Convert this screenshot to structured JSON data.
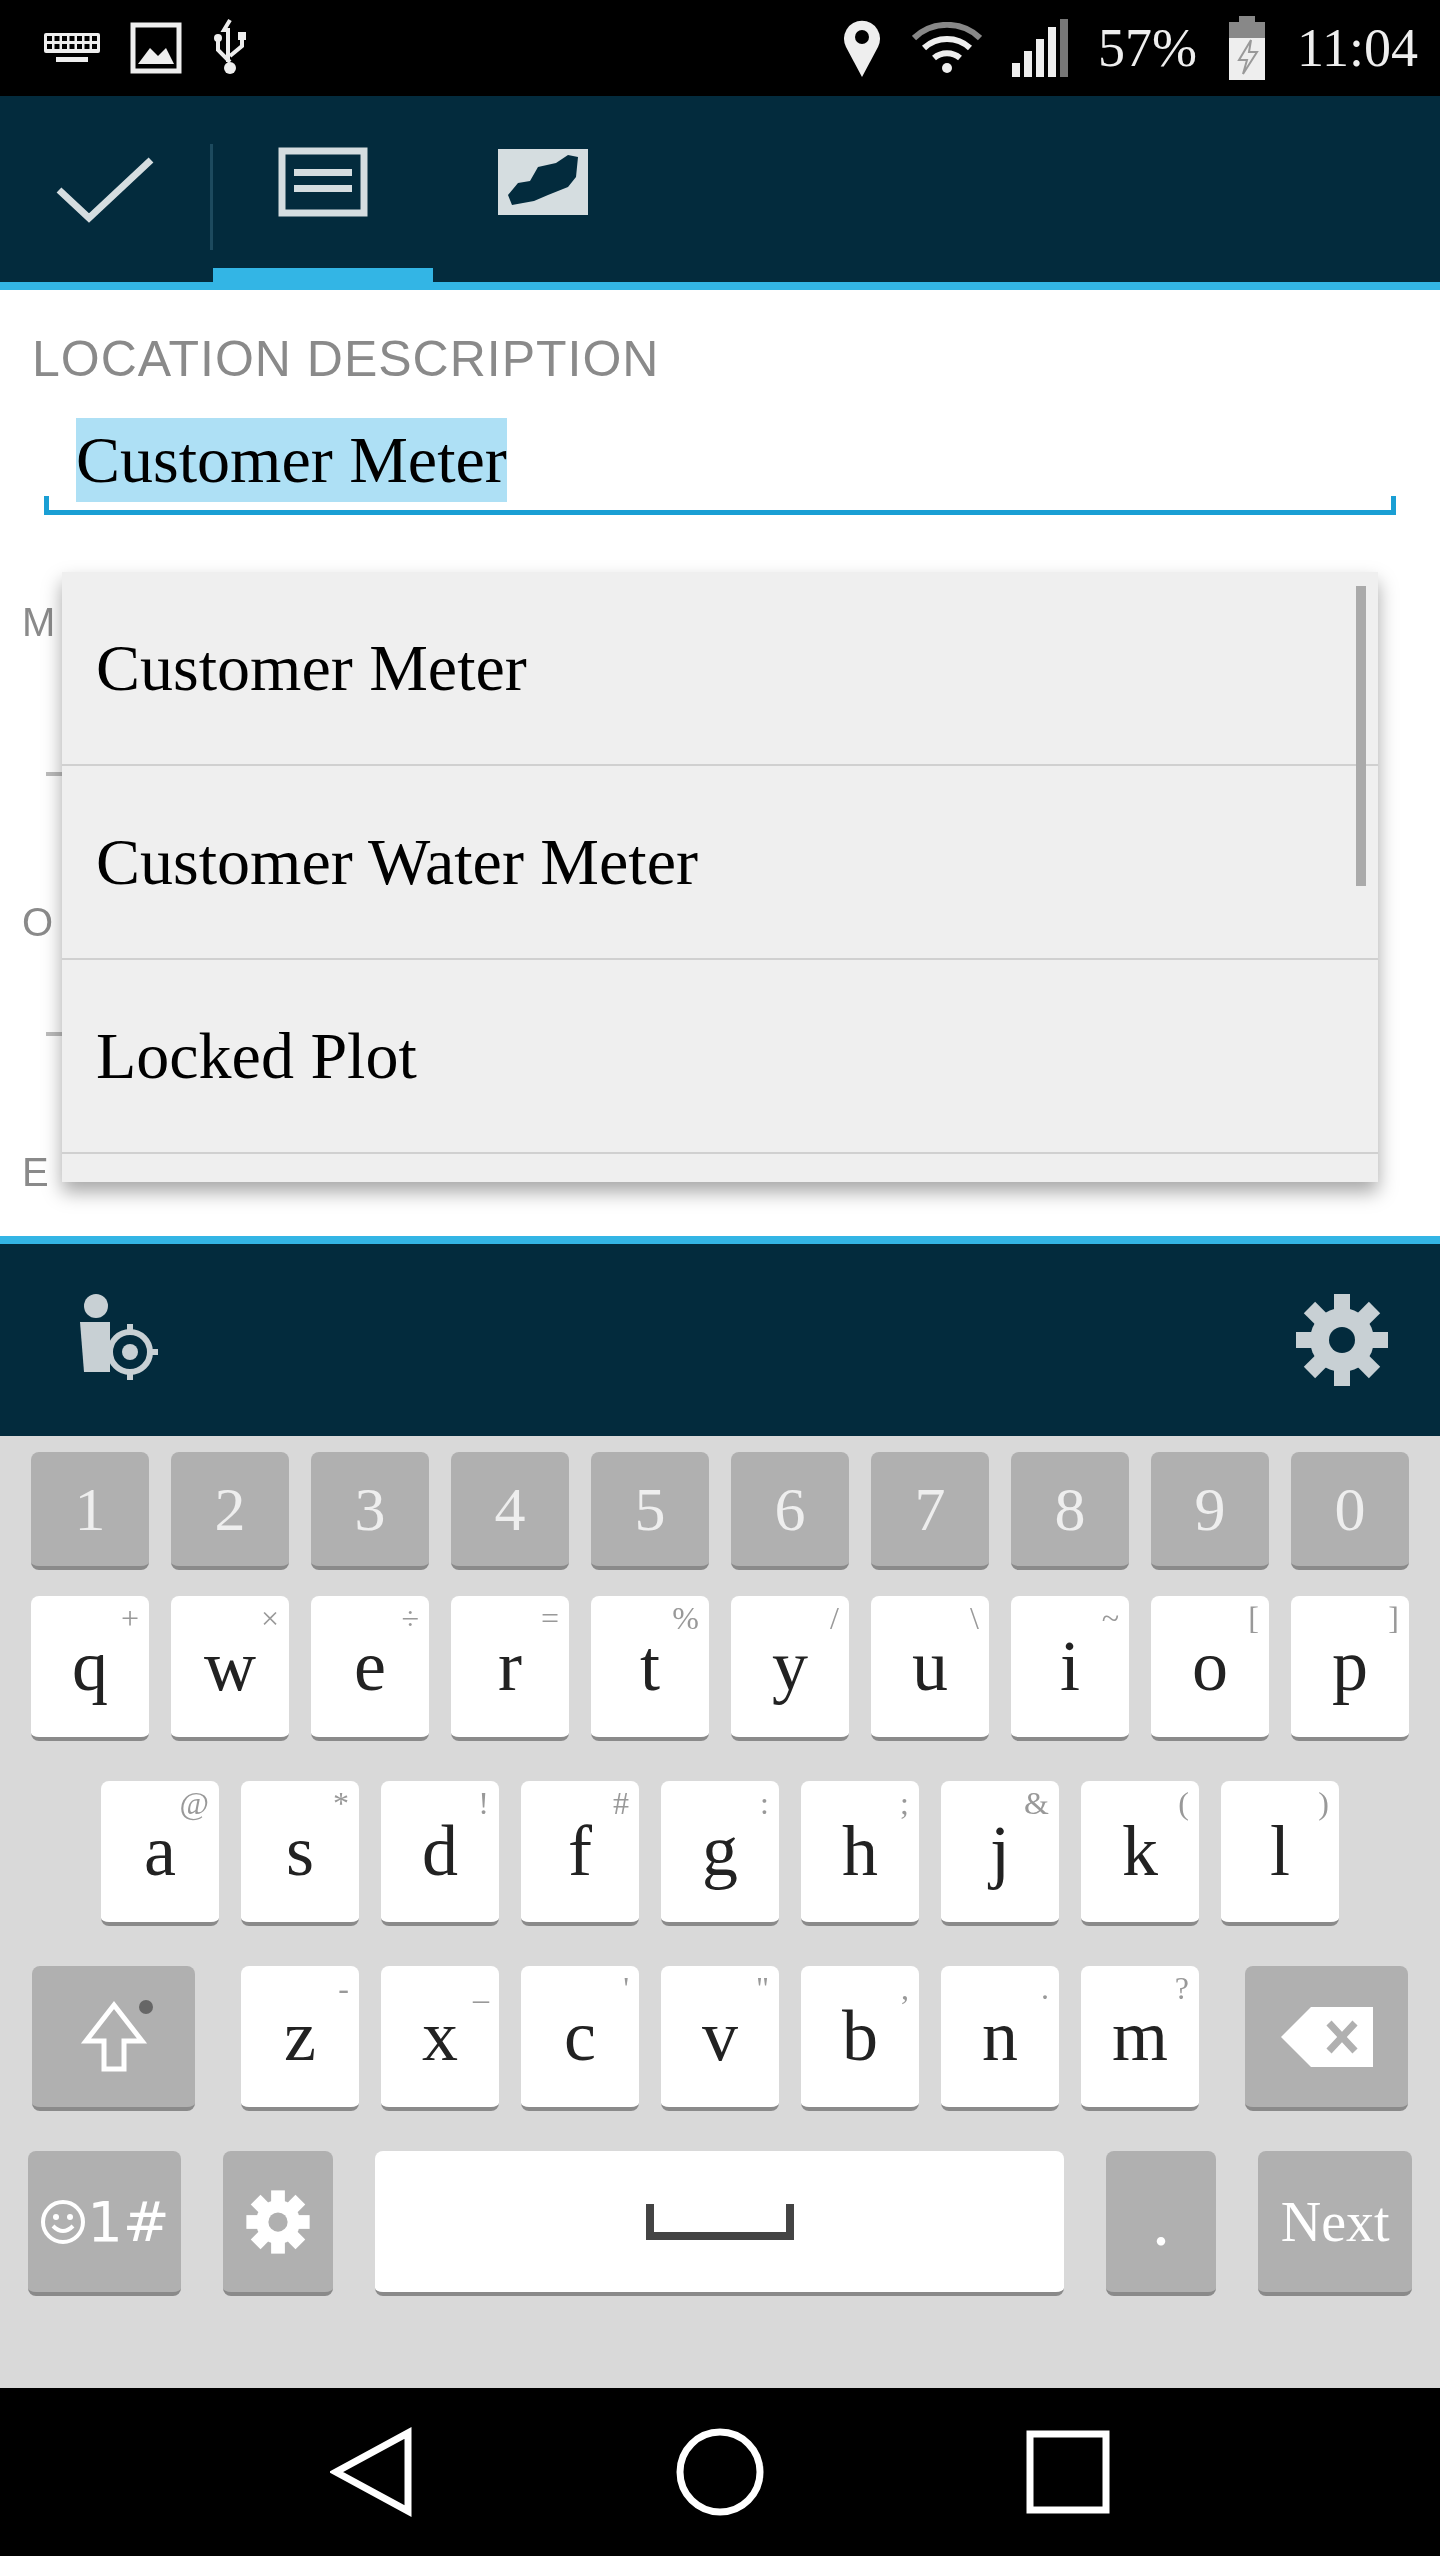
{
  "status_bar": {
    "battery": "57%",
    "time": "11:04"
  },
  "toolbar": {
    "tabs": [
      {
        "kind": "form",
        "selected": true
      },
      {
        "kind": "map",
        "selected": false
      }
    ]
  },
  "form": {
    "field": {
      "label": "LOCATION DESCRIPTION",
      "value": "Customer Meter",
      "selected": true
    },
    "hidden_labels": [
      "M",
      "O",
      "E"
    ]
  },
  "suggestions": [
    "Customer Meter",
    "Customer Water Meter",
    "Locked Plot"
  ],
  "keyboard": {
    "numbers": [
      "1",
      "2",
      "3",
      "4",
      "5",
      "6",
      "7",
      "8",
      "9",
      "0"
    ],
    "rows": [
      [
        {
          "label": "q",
          "hint": "+"
        },
        {
          "label": "w",
          "hint": "×"
        },
        {
          "label": "e",
          "hint": "÷"
        },
        {
          "label": "r",
          "hint": "="
        },
        {
          "label": "t",
          "hint": "%"
        },
        {
          "label": "y",
          "hint": "/"
        },
        {
          "label": "u",
          "hint": "\\"
        },
        {
          "label": "i",
          "hint": "~"
        },
        {
          "label": "o",
          "hint": "["
        },
        {
          "label": "p",
          "hint": "]"
        }
      ],
      [
        {
          "label": "a",
          "hint": "@"
        },
        {
          "label": "s",
          "hint": "*"
        },
        {
          "label": "d",
          "hint": "!"
        },
        {
          "label": "f",
          "hint": "#"
        },
        {
          "label": "g",
          "hint": ":"
        },
        {
          "label": "h",
          "hint": ";"
        },
        {
          "label": "j",
          "hint": "&"
        },
        {
          "label": "k",
          "hint": "("
        },
        {
          "label": "l",
          "hint": ")"
        }
      ],
      [
        {
          "label": "z",
          "hint": "-"
        },
        {
          "label": "x",
          "hint": "_"
        },
        {
          "label": "c",
          "hint": "'"
        },
        {
          "label": "v",
          "hint": "\""
        },
        {
          "label": "b",
          "hint": ","
        },
        {
          "label": "n",
          "hint": "."
        },
        {
          "label": "m",
          "hint": "?"
        }
      ]
    ],
    "symbols_key": "1#",
    "period_key": ".",
    "action_key": "Next"
  }
}
